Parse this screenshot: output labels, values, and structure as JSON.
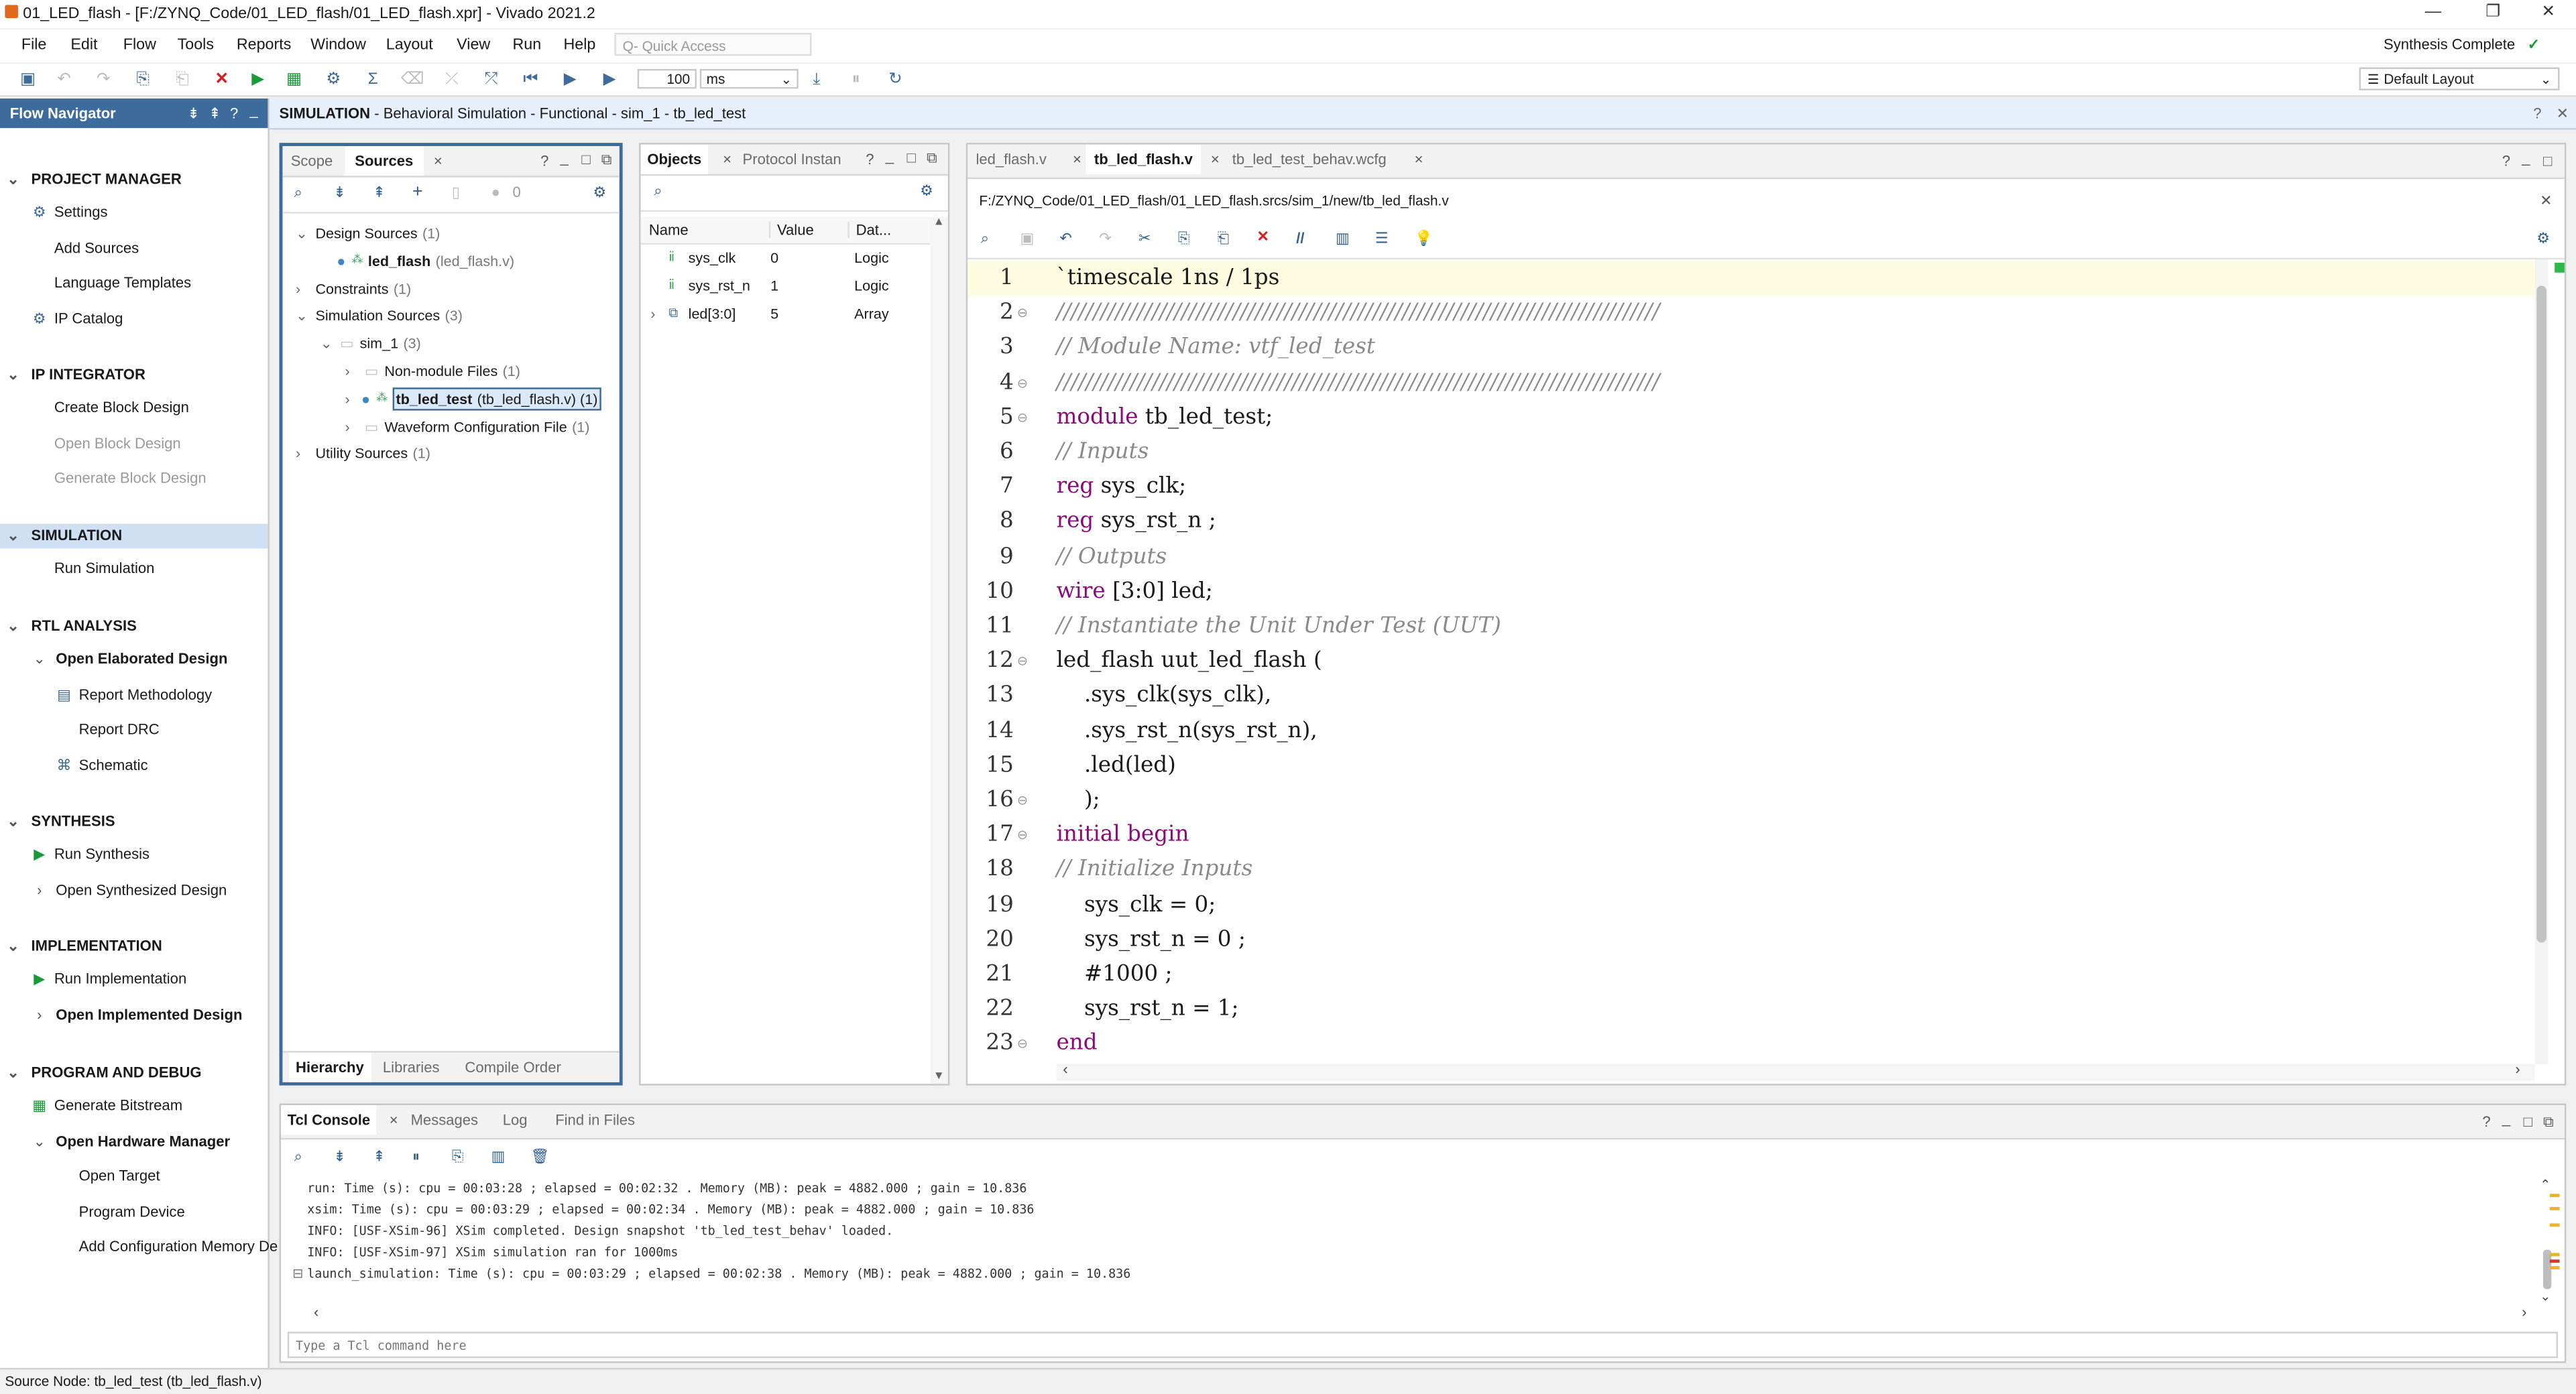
{
  "window": {
    "title": "01_LED_flash - [F:/ZYNQ_Code/01_LED_flash/01_LED_flash.xpr] - Vivado 2021.2",
    "status": "Synthesis Complete",
    "check": "✓"
  },
  "menu": [
    "File",
    "Edit",
    "Flow",
    "Tools",
    "Reports",
    "Window",
    "Layout",
    "View",
    "Run",
    "Help"
  ],
  "quick_access": {
    "placeholder": "Q- Quick Access"
  },
  "toolbar": {
    "run_time": "100",
    "unit": "ms",
    "layout": "Default Layout"
  },
  "flow_navigator": {
    "title": "Flow Navigator",
    "header_icons": [
      "⇟",
      "⇞",
      "?",
      "_"
    ],
    "sections": [
      {
        "label": "PROJECT MANAGER",
        "items": [
          {
            "label": "Settings",
            "icon": "⚙"
          },
          {
            "label": "Add Sources"
          },
          {
            "label": "Language Templates"
          },
          {
            "label": "IP Catalog",
            "icon": "⚙"
          }
        ]
      },
      {
        "label": "IP INTEGRATOR",
        "items": [
          {
            "label": "Create Block Design"
          },
          {
            "label": "Open Block Design",
            "disabled": true
          },
          {
            "label": "Generate Block Design",
            "disabled": true
          }
        ]
      },
      {
        "label": "SIMULATION",
        "selected": true,
        "items": [
          {
            "label": "Run Simulation"
          }
        ]
      },
      {
        "label": "RTL ANALYSIS",
        "items": [
          {
            "label": "Open Elaborated Design",
            "bold": true,
            "expand": true
          },
          {
            "label": "Report Methodology",
            "indent": 2,
            "icon": "▤"
          },
          {
            "label": "Report DRC",
            "indent": 2
          },
          {
            "label": "Schematic",
            "indent": 2,
            "icon": "⌘"
          }
        ]
      },
      {
        "label": "SYNTHESIS",
        "items": [
          {
            "label": "Run Synthesis",
            "icon": "▶"
          },
          {
            "label": "Open Synthesized Design",
            "expand": true,
            "collapsed": true
          }
        ]
      },
      {
        "label": "IMPLEMENTATION",
        "items": [
          {
            "label": "Run Implementation",
            "icon": "▶"
          },
          {
            "label": "Open Implemented Design",
            "bold": true,
            "expand": true,
            "collapsed": true
          }
        ]
      },
      {
        "label": "PROGRAM AND DEBUG",
        "items": [
          {
            "label": "Generate Bitstream",
            "icon": "▦"
          },
          {
            "label": "Open Hardware Manager",
            "bold": true,
            "expand": true
          },
          {
            "label": "Open Target",
            "indent": 2
          },
          {
            "label": "Program Device",
            "indent": 2
          },
          {
            "label": "Add Configuration Memory De",
            "indent": 2
          }
        ]
      }
    ]
  },
  "sim_header": {
    "prefix": "SIMULATION",
    "text": " - Behavioral Simulation - Functional - sim_1 - tb_led_test"
  },
  "sources_panel": {
    "tabs": [
      "Scope",
      "Sources"
    ],
    "close": "×",
    "count": "0",
    "tree": [
      {
        "label": "Design Sources",
        "suffix": "(1)",
        "level": 0,
        "expanded": true
      },
      {
        "label": "led_flash",
        "suffix": "(led_flash.v)",
        "level": 1,
        "bold": true,
        "file": true
      },
      {
        "label": "Constraints",
        "suffix": "(1)",
        "level": 0
      },
      {
        "label": "Simulation Sources",
        "suffix": "(3)",
        "level": 0,
        "expanded": true
      },
      {
        "label": "sim_1",
        "suffix": "(3)",
        "level": 1,
        "expanded": true,
        "folder": true
      },
      {
        "label": "Non-module Files",
        "suffix": "(1)",
        "level": 2,
        "folder": true
      },
      {
        "label": "tb_led_test",
        "suffix": "(tb_led_flash.v) (1)",
        "level": 2,
        "bold": true,
        "selected": true,
        "file": true
      },
      {
        "label": "Waveform Configuration File",
        "suffix": "(1)",
        "level": 2,
        "folder": true
      },
      {
        "label": "Utility Sources",
        "suffix": "(1)",
        "level": 0
      }
    ],
    "bottom_tabs": [
      "Hierarchy",
      "Libraries",
      "Compile Order"
    ]
  },
  "objects_panel": {
    "tabs": [
      "Objects",
      "Protocol Instan"
    ],
    "columns": [
      "Name",
      "Value",
      "Dat..."
    ],
    "rows": [
      {
        "name": "sys_clk",
        "value": "0",
        "type": "Logic"
      },
      {
        "name": "sys_rst_n",
        "value": "1",
        "type": "Logic"
      },
      {
        "name": "led[3:0]",
        "value": "5",
        "type": "Array"
      }
    ]
  },
  "editor": {
    "tabs": [
      "led_flash.v",
      "tb_led_flash.v",
      "tb_led_test_behav.wcfg"
    ],
    "path": "F:/ZYNQ_Code/01_LED_flash/01_LED_flash.srcs/sim_1/new/tb_led_flash.v",
    "lines": [
      {
        "n": "1",
        "text": "`timescale 1ns / 1ps",
        "style": "plain"
      },
      {
        "n": "2",
        "text": "//////////////////////////////////////////////////////////////////////////////////",
        "style": "comment"
      },
      {
        "n": "3",
        "text": "// Module Name: vtf_led_test",
        "style": "comment"
      },
      {
        "n": "4",
        "text": "//////////////////////////////////////////////////////////////////////////////////",
        "style": "comment"
      },
      {
        "n": "5",
        "kw": "module",
        "text": " tb_led_test;",
        "style": "kw"
      },
      {
        "n": "6",
        "text": "// Inputs",
        "style": "comment"
      },
      {
        "n": "7",
        "kw": "reg",
        "text": " sys_clk;",
        "style": "kw"
      },
      {
        "n": "8",
        "kw": "reg",
        "text": " sys_rst_n ;",
        "style": "kw"
      },
      {
        "n": "9",
        "text": "// Outputs",
        "style": "comment"
      },
      {
        "n": "10",
        "kw": "wire",
        "text": " [3:0] led;",
        "style": "kw"
      },
      {
        "n": "11",
        "text": "// Instantiate the Unit Under Test (UUT)",
        "style": "comment"
      },
      {
        "n": "12",
        "text": "led_flash uut_led_flash (",
        "style": "plain"
      },
      {
        "n": "13",
        "text": "    .sys_clk(sys_clk),",
        "style": "plain"
      },
      {
        "n": "14",
        "text": "    .sys_rst_n(sys_rst_n),",
        "style": "plain"
      },
      {
        "n": "15",
        "text": "    .led(led)",
        "style": "plain"
      },
      {
        "n": "16",
        "text": "    );",
        "style": "plain"
      },
      {
        "n": "17",
        "kw": "initial begin",
        "text": "",
        "style": "kw"
      },
      {
        "n": "18",
        "text": "// Initialize Inputs",
        "style": "comment"
      },
      {
        "n": "19",
        "text": "    sys_clk = 0;",
        "style": "plain"
      },
      {
        "n": "20",
        "text": "    sys_rst_n = 0 ;",
        "style": "plain"
      },
      {
        "n": "21",
        "text": "    #1000 ;",
        "style": "plain"
      },
      {
        "n": "22",
        "text": "    sys_rst_n = 1;",
        "style": "plain"
      },
      {
        "n": "23",
        "kw": "end",
        "text": "",
        "style": "kw"
      }
    ]
  },
  "console": {
    "tabs": [
      "Tcl Console",
      "Messages",
      "Log",
      "Find in Files"
    ],
    "lines": [
      "run: Time (s): cpu = 00:03:28 ; elapsed = 00:02:32 . Memory (MB): peak = 4882.000 ; gain = 10.836",
      "xsim: Time (s): cpu = 00:03:29 ; elapsed = 00:02:34 . Memory (MB): peak = 4882.000 ; gain = 10.836",
      "INFO: [USF-XSim-96] XSim completed. Design snapshot 'tb_led_test_behav' loaded.",
      "INFO: [USF-XSim-97] XSim simulation ran for 1000ms",
      "launch_simulation: Time (s): cpu = 00:03:29 ; elapsed = 00:02:38 . Memory (MB): peak = 4882.000 ; gain = 10.836"
    ],
    "input_placeholder": "Type a Tcl command here"
  },
  "statusbar": {
    "text": "Source Node: tb_led_test (tb_led_flash.v)"
  }
}
